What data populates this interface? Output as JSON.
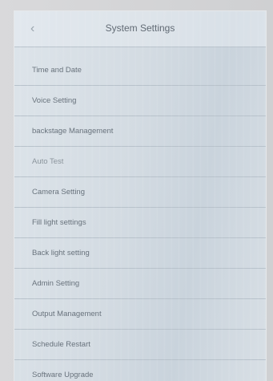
{
  "header": {
    "back_icon": "chevron-left-icon",
    "title": "System Settings"
  },
  "menu": [
    "Time and Date",
    "Voice Setting",
    "backstage Management",
    "Auto Test",
    "Camera Setting",
    "Fill light settings",
    "Back light setting",
    "Admin Setting",
    "Output Management",
    "Schedule Restart",
    "Software Upgrade"
  ]
}
